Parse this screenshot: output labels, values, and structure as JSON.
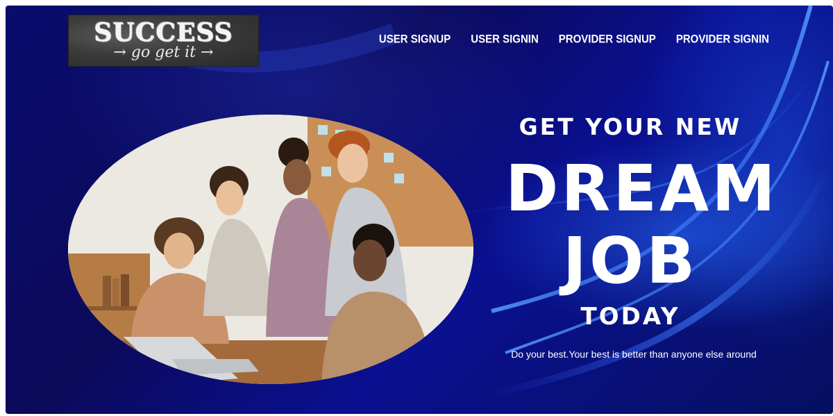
{
  "logo": {
    "title": "SUCCESS",
    "subtitle": "→ go get it →"
  },
  "nav": {
    "items": [
      {
        "label": "USER SIGNUP"
      },
      {
        "label": "USER SIGNIN"
      },
      {
        "label": "PROVIDER SIGNUP"
      },
      {
        "label": "PROVIDER SIGNIN"
      }
    ]
  },
  "hero": {
    "line1": "GET YOUR NEW",
    "line2": "DREAM",
    "line3": "JOB",
    "line4": "TODAY",
    "tagline": "Do your best.Your best is better than anyone else around"
  },
  "colors": {
    "background": "#0a0c6e",
    "accent_blue": "#286eff",
    "text": "#ffffff"
  }
}
